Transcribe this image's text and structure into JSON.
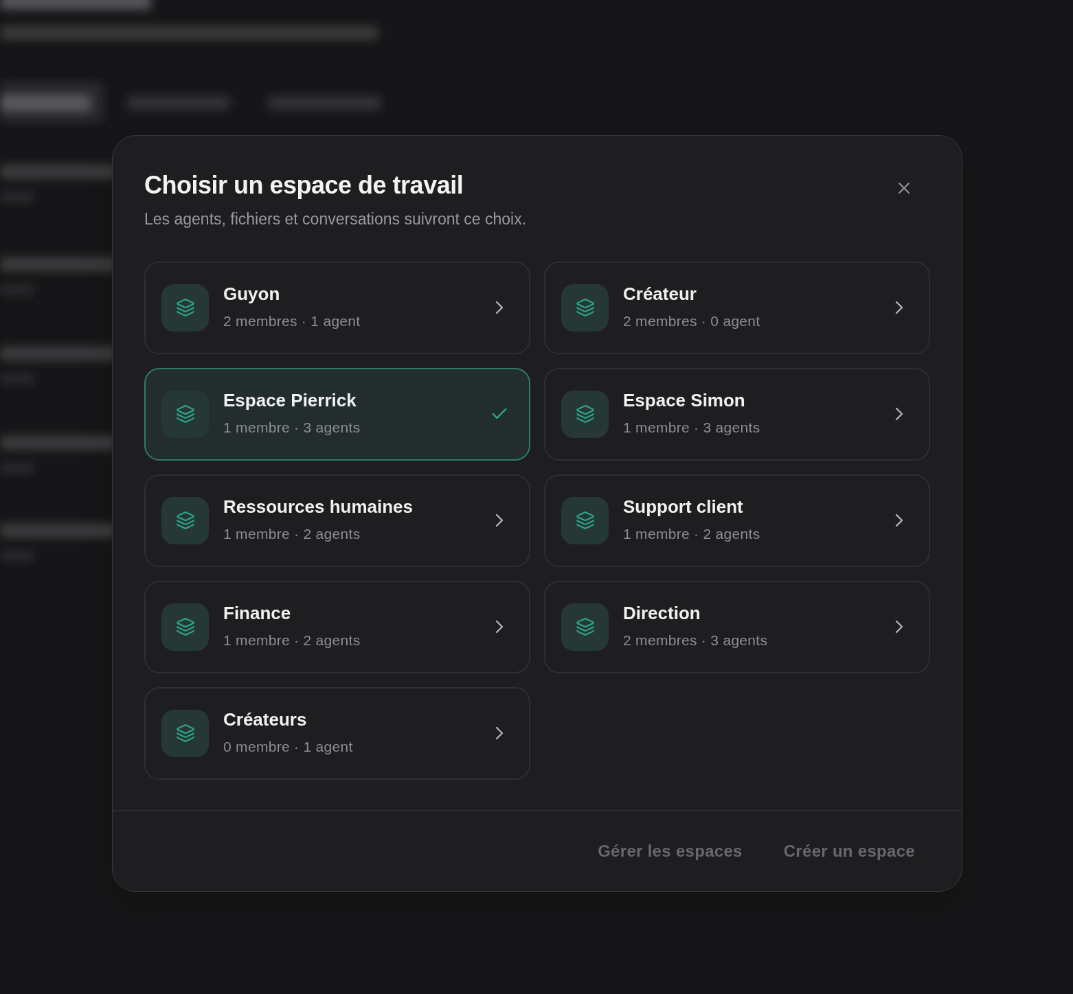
{
  "dialog": {
    "title": "Choisir un espace de travail",
    "subtitle": "Les agents, fichiers et conversations suivront ce choix.",
    "workspaces": [
      {
        "name": "Guyon",
        "meta": "2 membres · 1 agent",
        "selected": false
      },
      {
        "name": "Créateur",
        "meta": "2 membres · 0 agent",
        "selected": false
      },
      {
        "name": "Espace Pierrick",
        "meta": "1 membre · 3 agents",
        "selected": true
      },
      {
        "name": "Espace Simon",
        "meta": "1 membre · 3 agents",
        "selected": false
      },
      {
        "name": "Ressources humaines",
        "meta": "1 membre · 2 agents",
        "selected": false
      },
      {
        "name": "Support client",
        "meta": "1 membre · 2 agents",
        "selected": false
      },
      {
        "name": "Finance",
        "meta": "1 membre · 2 agents",
        "selected": false
      },
      {
        "name": "Direction",
        "meta": "2 membres · 3 agents",
        "selected": false
      },
      {
        "name": "Créateurs",
        "meta": "0 membre · 1 agent",
        "selected": false
      }
    ],
    "footer_buttons": [
      "Gérer les espaces",
      "Créer un espace"
    ]
  }
}
